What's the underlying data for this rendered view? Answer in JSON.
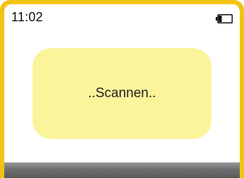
{
  "status_bar": {
    "time": "11:02",
    "battery_icon": "battery-low-icon",
    "battery_level": 0.25
  },
  "message": {
    "text": "..Scannen.."
  },
  "colors": {
    "frame": "#f3c313",
    "message_bg": "#fbf49a",
    "bottom_bar": "#6e6e6e"
  }
}
